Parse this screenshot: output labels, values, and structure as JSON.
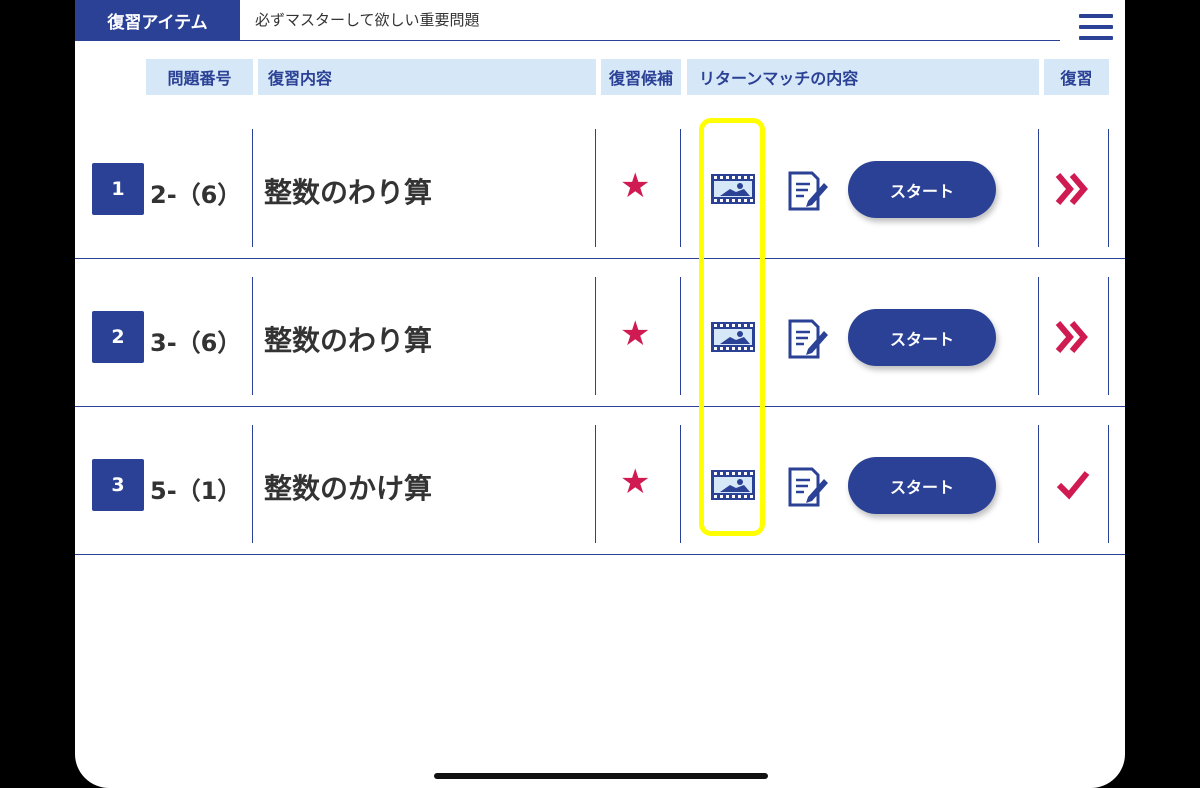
{
  "header": {
    "tab_label": "復習アイテム",
    "subtitle": "必ずマスターして欲しい重要問題"
  },
  "columns": {
    "number": "問題番号",
    "content": "復習内容",
    "candidate": "復習候補",
    "rematch": "リターンマッチの内容",
    "review": "復習"
  },
  "rows": [
    {
      "index": "1",
      "code": "2-（6）",
      "content": "整数のわり算",
      "candidate": "★",
      "start_label": "スタート",
      "review_status": "next"
    },
    {
      "index": "2",
      "code": "3-（6）",
      "content": "整数のわり算",
      "candidate": "★",
      "start_label": "スタート",
      "review_status": "next"
    },
    {
      "index": "3",
      "code": "5-（1）",
      "content": "整数のかけ算",
      "candidate": "★",
      "start_label": "スタート",
      "review_status": "done"
    }
  ],
  "colors": {
    "brand": "#2a4196",
    "accent": "#cf1a52",
    "header_bg": "#d6e7f7",
    "highlight": "#ffff00"
  },
  "icons": {
    "menu": "hamburger-menu-icon",
    "video": "video-film-icon",
    "edit": "edit-note-icon",
    "next": "double-chevron-right-icon",
    "done": "checkmark-icon"
  }
}
